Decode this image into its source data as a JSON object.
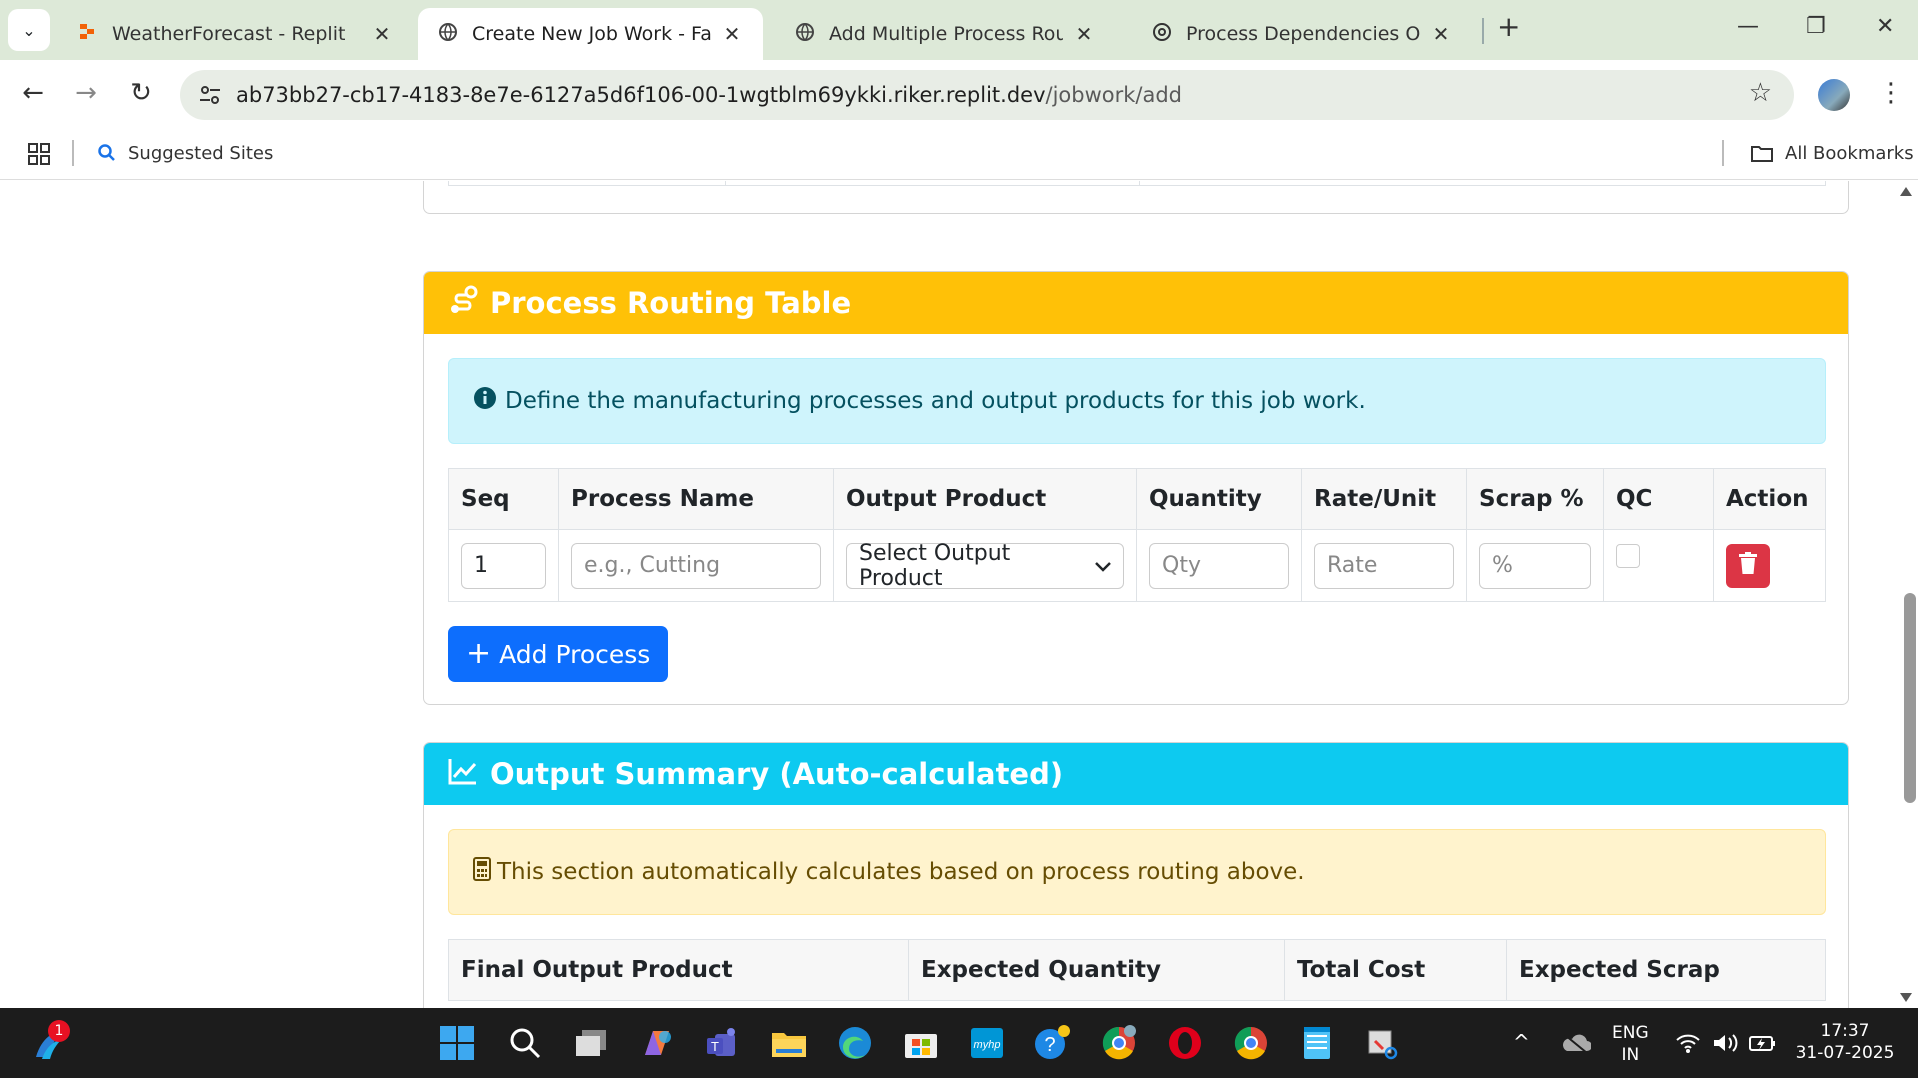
{
  "browser": {
    "tabs": [
      {
        "title": "WeatherForecast - Replit",
        "icon": "replit-icon"
      },
      {
        "title": "Create New Job Work - Factory",
        "icon": "globe-icon",
        "active": true
      },
      {
        "title": "Add Multiple Process Routing -",
        "icon": "globe-icon"
      },
      {
        "title": "Process Dependencies Overview",
        "icon": "chatgpt-icon"
      }
    ],
    "url_host": "ab73bb27-cb17-4183-8e7e-6127a5d6f106-00-1wgtblm69ykki.riker.replit.dev",
    "url_path": "/jobwork/add",
    "bookmarks": {
      "suggested": "Suggested Sites",
      "all": "All Bookmarks"
    }
  },
  "process_routing": {
    "header": "Process Routing Table",
    "header_color": "#ffc107",
    "info": "Define the manufacturing processes and output products for this job work.",
    "columns": [
      "Seq",
      "Process Name",
      "Output Product",
      "Quantity",
      "Rate/Unit",
      "Scrap %",
      "QC",
      "Action"
    ],
    "row": {
      "seq": "1",
      "process_placeholder": "e.g., Cutting",
      "output_product": "Select Output Product",
      "qty_placeholder": "Qty",
      "rate_placeholder": "Rate",
      "scrap_placeholder": "%",
      "qc_checked": false
    },
    "add_button": "Add Process"
  },
  "output_summary": {
    "header": "Output Summary (Auto-calculated)",
    "header_color": "#0dcaf0",
    "info": "This section automatically calculates based on process routing above.",
    "columns": [
      "Final Output Product",
      "Expected Quantity",
      "Total Cost",
      "Expected Scrap"
    ]
  },
  "taskbar": {
    "notification_count": "1",
    "lang": "ENG",
    "region": "IN",
    "time": "17:37",
    "date": "31-07-2025"
  }
}
